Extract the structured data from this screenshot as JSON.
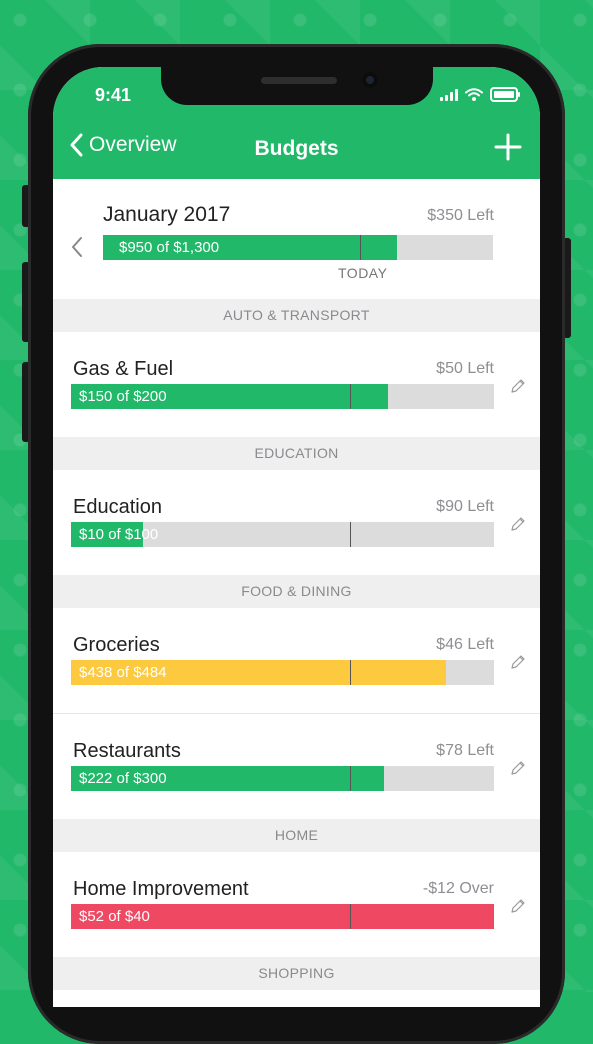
{
  "status_bar": {
    "time": "9:41"
  },
  "nav": {
    "back_label": "Overview",
    "title": "Budgets"
  },
  "month": {
    "title": "January 2017",
    "left_text": "$350 Left",
    "bar_label": "$950 of $1,300",
    "progress": 0.754,
    "today_label": "TODAY",
    "today_position": 0.66
  },
  "colors": {
    "green": "#22b86a",
    "yellow": "#fdc93f",
    "red": "#ee4862",
    "track": "#dcdcdc"
  },
  "sections": [
    {
      "label": "AUTO & TRANSPORT",
      "items": [
        {
          "name": "Gas & Fuel",
          "left_text": "$50 Left",
          "bar_label": "$150 of $200",
          "progress": 0.75,
          "status": "green"
        }
      ]
    },
    {
      "label": "EDUCATION",
      "items": [
        {
          "name": "Education",
          "left_text": "$90 Left",
          "bar_label": "$10 of $100",
          "progress": 0.17,
          "status": "green"
        }
      ]
    },
    {
      "label": "FOOD & DINING",
      "items": [
        {
          "name": "Groceries",
          "left_text": "$46 Left",
          "bar_label": "$438 of $484",
          "progress": 0.886,
          "status": "yellow"
        },
        {
          "name": "Restaurants",
          "left_text": "$78 Left",
          "bar_label": "$222 of $300",
          "progress": 0.74,
          "status": "green"
        }
      ]
    },
    {
      "label": "HOME",
      "items": [
        {
          "name": "Home Improvement",
          "left_text": "-$12 Over",
          "bar_label": "$52 of $40",
          "progress": 1.0,
          "status": "red"
        }
      ]
    },
    {
      "label": "SHOPPING",
      "items": []
    }
  ]
}
